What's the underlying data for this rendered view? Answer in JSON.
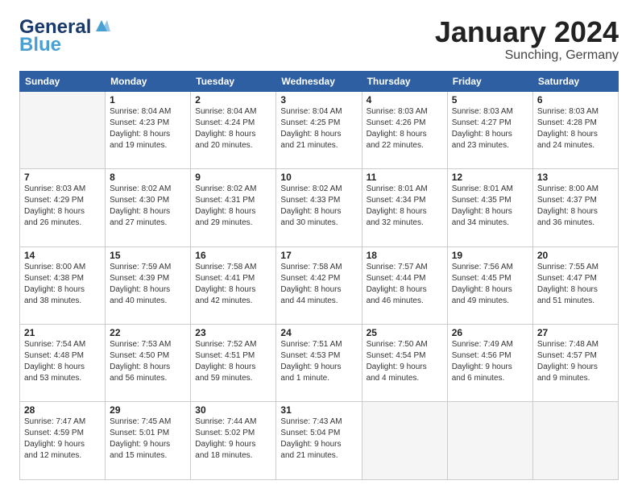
{
  "logo": {
    "line1": "General",
    "line2": "Blue",
    "color_general": "#1a3a6b",
    "color_blue": "#4a9fd4"
  },
  "header": {
    "title": "January 2024",
    "subtitle": "Sunching, Germany"
  },
  "weekdays": [
    "Sunday",
    "Monday",
    "Tuesday",
    "Wednesday",
    "Thursday",
    "Friday",
    "Saturday"
  ],
  "weeks": [
    [
      {
        "day": "",
        "info": ""
      },
      {
        "day": "1",
        "info": "Sunrise: 8:04 AM\nSunset: 4:23 PM\nDaylight: 8 hours\nand 19 minutes."
      },
      {
        "day": "2",
        "info": "Sunrise: 8:04 AM\nSunset: 4:24 PM\nDaylight: 8 hours\nand 20 minutes."
      },
      {
        "day": "3",
        "info": "Sunrise: 8:04 AM\nSunset: 4:25 PM\nDaylight: 8 hours\nand 21 minutes."
      },
      {
        "day": "4",
        "info": "Sunrise: 8:03 AM\nSunset: 4:26 PM\nDaylight: 8 hours\nand 22 minutes."
      },
      {
        "day": "5",
        "info": "Sunrise: 8:03 AM\nSunset: 4:27 PM\nDaylight: 8 hours\nand 23 minutes."
      },
      {
        "day": "6",
        "info": "Sunrise: 8:03 AM\nSunset: 4:28 PM\nDaylight: 8 hours\nand 24 minutes."
      }
    ],
    [
      {
        "day": "7",
        "info": "Sunrise: 8:03 AM\nSunset: 4:29 PM\nDaylight: 8 hours\nand 26 minutes."
      },
      {
        "day": "8",
        "info": "Sunrise: 8:02 AM\nSunset: 4:30 PM\nDaylight: 8 hours\nand 27 minutes."
      },
      {
        "day": "9",
        "info": "Sunrise: 8:02 AM\nSunset: 4:31 PM\nDaylight: 8 hours\nand 29 minutes."
      },
      {
        "day": "10",
        "info": "Sunrise: 8:02 AM\nSunset: 4:33 PM\nDaylight: 8 hours\nand 30 minutes."
      },
      {
        "day": "11",
        "info": "Sunrise: 8:01 AM\nSunset: 4:34 PM\nDaylight: 8 hours\nand 32 minutes."
      },
      {
        "day": "12",
        "info": "Sunrise: 8:01 AM\nSunset: 4:35 PM\nDaylight: 8 hours\nand 34 minutes."
      },
      {
        "day": "13",
        "info": "Sunrise: 8:00 AM\nSunset: 4:37 PM\nDaylight: 8 hours\nand 36 minutes."
      }
    ],
    [
      {
        "day": "14",
        "info": "Sunrise: 8:00 AM\nSunset: 4:38 PM\nDaylight: 8 hours\nand 38 minutes."
      },
      {
        "day": "15",
        "info": "Sunrise: 7:59 AM\nSunset: 4:39 PM\nDaylight: 8 hours\nand 40 minutes."
      },
      {
        "day": "16",
        "info": "Sunrise: 7:58 AM\nSunset: 4:41 PM\nDaylight: 8 hours\nand 42 minutes."
      },
      {
        "day": "17",
        "info": "Sunrise: 7:58 AM\nSunset: 4:42 PM\nDaylight: 8 hours\nand 44 minutes."
      },
      {
        "day": "18",
        "info": "Sunrise: 7:57 AM\nSunset: 4:44 PM\nDaylight: 8 hours\nand 46 minutes."
      },
      {
        "day": "19",
        "info": "Sunrise: 7:56 AM\nSunset: 4:45 PM\nDaylight: 8 hours\nand 49 minutes."
      },
      {
        "day": "20",
        "info": "Sunrise: 7:55 AM\nSunset: 4:47 PM\nDaylight: 8 hours\nand 51 minutes."
      }
    ],
    [
      {
        "day": "21",
        "info": "Sunrise: 7:54 AM\nSunset: 4:48 PM\nDaylight: 8 hours\nand 53 minutes."
      },
      {
        "day": "22",
        "info": "Sunrise: 7:53 AM\nSunset: 4:50 PM\nDaylight: 8 hours\nand 56 minutes."
      },
      {
        "day": "23",
        "info": "Sunrise: 7:52 AM\nSunset: 4:51 PM\nDaylight: 8 hours\nand 59 minutes."
      },
      {
        "day": "24",
        "info": "Sunrise: 7:51 AM\nSunset: 4:53 PM\nDaylight: 9 hours\nand 1 minute."
      },
      {
        "day": "25",
        "info": "Sunrise: 7:50 AM\nSunset: 4:54 PM\nDaylight: 9 hours\nand 4 minutes."
      },
      {
        "day": "26",
        "info": "Sunrise: 7:49 AM\nSunset: 4:56 PM\nDaylight: 9 hours\nand 6 minutes."
      },
      {
        "day": "27",
        "info": "Sunrise: 7:48 AM\nSunset: 4:57 PM\nDaylight: 9 hours\nand 9 minutes."
      }
    ],
    [
      {
        "day": "28",
        "info": "Sunrise: 7:47 AM\nSunset: 4:59 PM\nDaylight: 9 hours\nand 12 minutes."
      },
      {
        "day": "29",
        "info": "Sunrise: 7:45 AM\nSunset: 5:01 PM\nDaylight: 9 hours\nand 15 minutes."
      },
      {
        "day": "30",
        "info": "Sunrise: 7:44 AM\nSunset: 5:02 PM\nDaylight: 9 hours\nand 18 minutes."
      },
      {
        "day": "31",
        "info": "Sunrise: 7:43 AM\nSunset: 5:04 PM\nDaylight: 9 hours\nand 21 minutes."
      },
      {
        "day": "",
        "info": ""
      },
      {
        "day": "",
        "info": ""
      },
      {
        "day": "",
        "info": ""
      }
    ]
  ]
}
